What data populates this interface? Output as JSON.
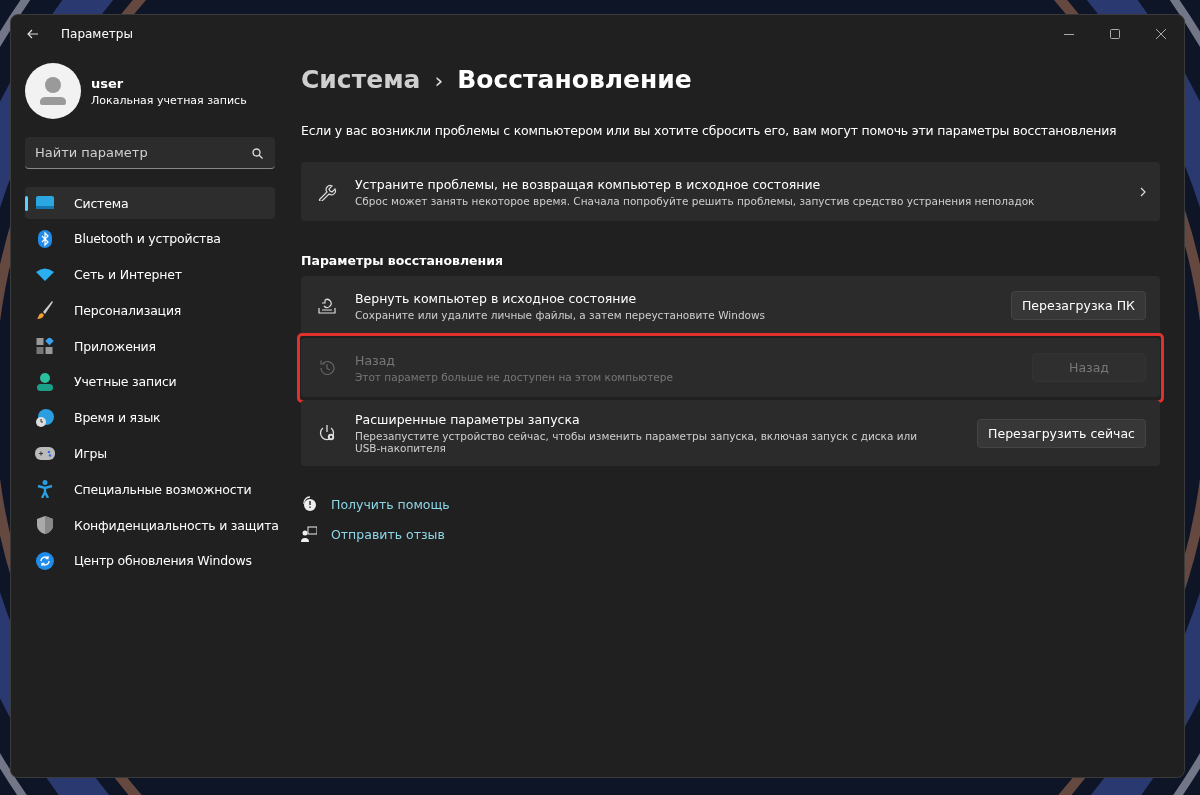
{
  "window": {
    "title": "Параметры"
  },
  "account": {
    "name": "user",
    "type": "Локальная учетная запись"
  },
  "search": {
    "placeholder": "Найти параметр"
  },
  "nav": [
    {
      "label": "Система",
      "selected": true
    },
    {
      "label": "Bluetooth и устройства",
      "selected": false
    },
    {
      "label": "Сеть и Интернет",
      "selected": false
    },
    {
      "label": "Персонализация",
      "selected": false
    },
    {
      "label": "Приложения",
      "selected": false
    },
    {
      "label": "Учетные записи",
      "selected": false
    },
    {
      "label": "Время и язык",
      "selected": false
    },
    {
      "label": "Игры",
      "selected": false
    },
    {
      "label": "Специальные возможности",
      "selected": false
    },
    {
      "label": "Конфиденциальность и защита",
      "selected": false
    },
    {
      "label": "Центр обновления Windows",
      "selected": false
    }
  ],
  "breadcrumb": {
    "parent": "Система",
    "separator": "›",
    "current": "Восстановление"
  },
  "description": "Если у вас возникли проблемы с компьютером или вы хотите сбросить его, вам могут помочь эти параметры восстановления",
  "troubleshoot": {
    "title": "Устраните проблемы, не возвращая компьютер в исходное состояние",
    "subtitle": "Сброс может занять некоторое время. Сначала попробуйте решить проблемы, запустив средство устранения неполадок"
  },
  "section_title": "Параметры восстановления",
  "options": [
    {
      "title": "Вернуть компьютер в исходное состояние",
      "subtitle": "Сохраните или удалите личные файлы, а затем переустановите Windows",
      "button": "Перезагрузка ПК",
      "disabled": false,
      "highlighted": false
    },
    {
      "title": "Назад",
      "subtitle": "Этот параметр больше не доступен на этом компьютере",
      "button": "Назад",
      "disabled": true,
      "highlighted": true
    },
    {
      "title": "Расширенные параметры запуска",
      "subtitle": "Перезапустите устройство сейчас, чтобы изменить параметры запуска, включая запуск с диска или USB-накопителя",
      "button": "Перезагрузить сейчас",
      "disabled": false,
      "highlighted": false
    }
  ],
  "links": [
    {
      "label": "Получить помощь"
    },
    {
      "label": "Отправить отзыв"
    }
  ]
}
